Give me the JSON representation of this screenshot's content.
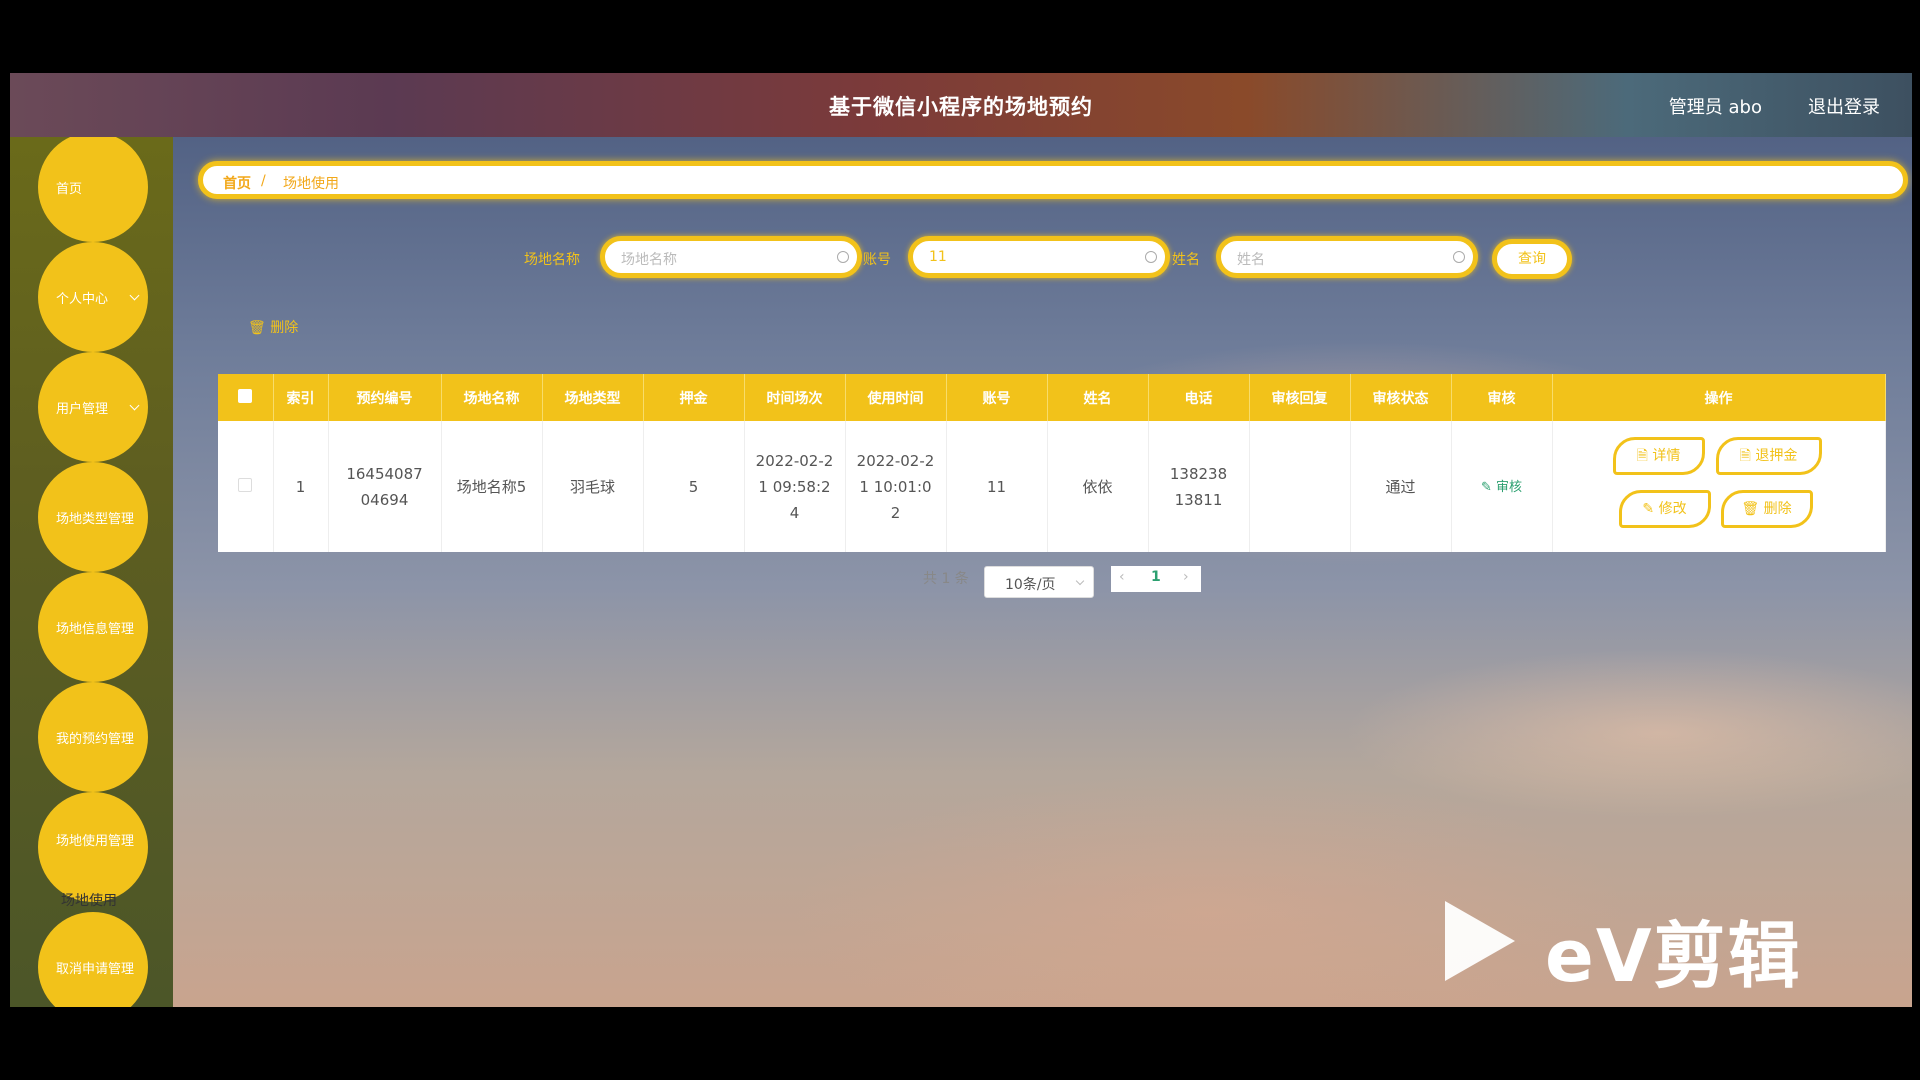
{
  "header": {
    "title": "基于微信小程序的场地预约",
    "user": "管理员 abo",
    "logout": "退出登录"
  },
  "sidebar": {
    "items": [
      {
        "label": "首页"
      },
      {
        "label": "个人中心"
      },
      {
        "label": "用户管理"
      },
      {
        "label": "场地类型管理"
      },
      {
        "label": "场地信息管理"
      },
      {
        "label": "我的预约管理"
      },
      {
        "label": "场地使用管理"
      },
      {
        "label": "取消申请管理"
      }
    ],
    "subitem": "场地使用"
  },
  "breadcrumb": {
    "home": "首页",
    "sep": "/",
    "current": "场地使用"
  },
  "search": {
    "venue_label": "场地名称",
    "venue_placeholder": "场地名称",
    "account_label": "账号",
    "account_value": "11",
    "name_label": "姓名",
    "name_placeholder": "姓名",
    "query_button": "查询"
  },
  "bulk_delete": "删除",
  "table": {
    "headers": [
      "索引",
      "预约编号",
      "场地名称",
      "场地类型",
      "押金",
      "时间场次",
      "使用时间",
      "账号",
      "姓名",
      "电话",
      "审核回复",
      "审核状态",
      "审核",
      "操作"
    ],
    "rows": [
      {
        "index": "1",
        "booking_no": "1645408704694",
        "venue_name": "场地名称5",
        "venue_type": "羽毛球",
        "deposit": "5",
        "session_time": "2022-02-21 09:58:24",
        "use_time": "2022-02-21 10:01:02",
        "account": "11",
        "name": "依依",
        "phone": "13823813811",
        "audit_reply": "",
        "audit_status": "通过",
        "audit_link": "审核",
        "actions": {
          "detail": "详情",
          "refund": "退押金",
          "edit": "修改",
          "delete": "删除"
        }
      }
    ]
  },
  "pager": {
    "total": "共 1 条",
    "size": "10条/页",
    "current": "1"
  },
  "watermark": "eV剪辑",
  "colors": {
    "accent": "#f2c21a",
    "success": "#2ca070"
  }
}
